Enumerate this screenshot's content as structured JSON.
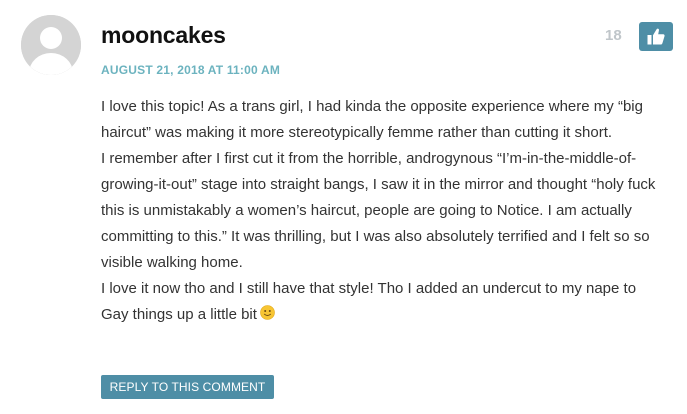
{
  "comment": {
    "author": "mooncakes",
    "date": "AUGUST 21, 2018 AT 11:00 AM",
    "votes": "18",
    "paragraphs": [
      "I love this topic! As a trans girl, I had kinda the opposite experience where my “big haircut” was making it more stereotypically femme rather than cutting it short.",
      "I remember after I first cut it from the horrible, androgynous “I’m-in-the-middle-of-growing-it-out” stage into straight bangs, I saw it in the mirror and thought “holy fuck this is unmistakably a women’s haircut, people are going to Notice. I am actually committing to this.” It was thrilling, but I was also absolutely terrified and I felt so so visible walking home.",
      "I love it now tho and I still have that style! Tho I added an undercut to my nape to Gay things up a little bit"
    ],
    "reply_label": "REPLY TO THIS COMMENT"
  },
  "icons": {
    "avatar": "default-avatar-icon",
    "like": "thumbs-up-icon",
    "emoji": "slightly-smiling-face-icon"
  },
  "colors": {
    "accent": "#4e8ea6",
    "date": "#6cb3bf",
    "votes": "#c0c6ca",
    "text": "#333333"
  }
}
